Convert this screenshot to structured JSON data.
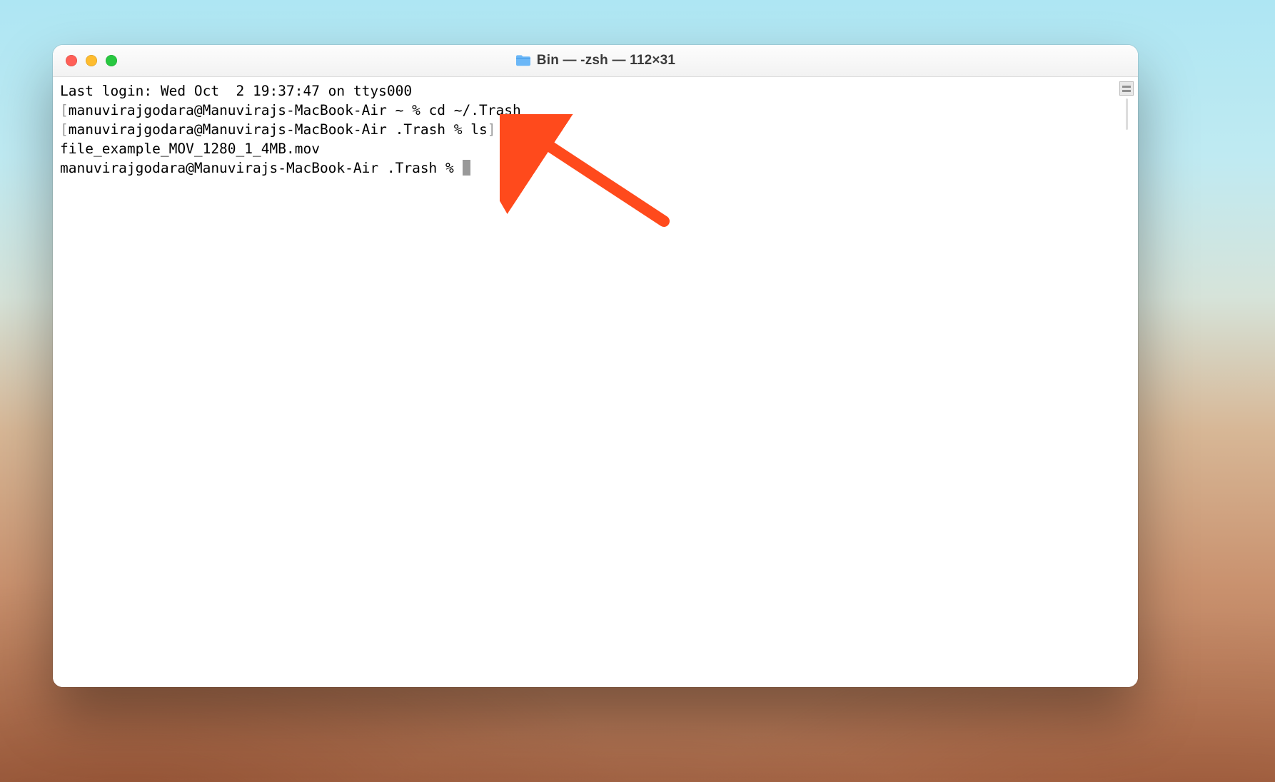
{
  "window": {
    "title": "Bin — -zsh — 112×31"
  },
  "terminal": {
    "lines": [
      {
        "prefix": "",
        "text": "Last login: Wed Oct  2 19:37:47 on ttys000",
        "suffix": ""
      },
      {
        "prefix": "[",
        "text": "manuvirajgodara@Manuvirajs-MacBook-Air ~ % cd ~/.Trash",
        "suffix": ""
      },
      {
        "prefix": "[",
        "text": "manuvirajgodara@Manuvirajs-MacBook-Air .Trash % ls",
        "suffix": "]"
      },
      {
        "prefix": "",
        "text": "file_example_MOV_1280_1_4MB.mov",
        "suffix": ""
      },
      {
        "prefix": "",
        "text": "manuvirajgodara@Manuvirajs-MacBook-Air .Trash % ",
        "suffix": "",
        "cursor": true
      }
    ]
  },
  "annotation": {
    "arrow_color": "#ff4a1c"
  }
}
